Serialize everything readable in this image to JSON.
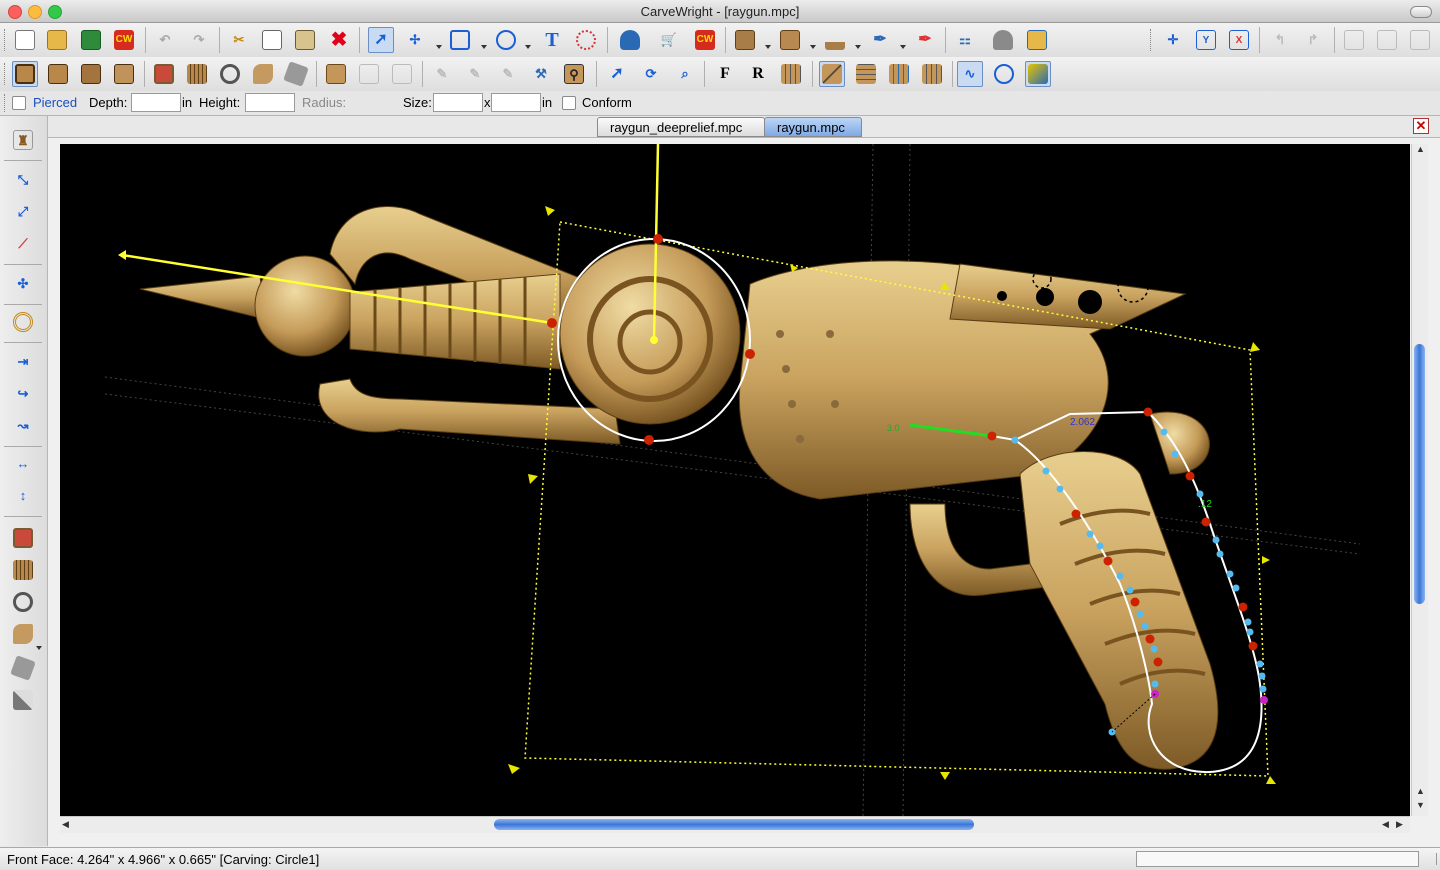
{
  "window": {
    "title": "CarveWright - [raygun.mpc]"
  },
  "toolbar_row1": {
    "icons": [
      "new-file-icon",
      "open-file-icon",
      "save-icon",
      "cw-icon",
      "undo-icon",
      "redo-icon",
      "cut-icon",
      "copy-icon",
      "paste-icon",
      "delete-icon",
      "select-arrow-icon",
      "node-edit-icon",
      "rectangle-icon",
      "circle-icon",
      "text-icon",
      "shell-pattern-icon",
      "shell-icon",
      "cart-icon",
      "cw-red-icon",
      "book-icon",
      "cut-path-icon",
      "bit-icon",
      "feather-icon",
      "feather-alt-icon",
      "tree-icon",
      "duck-icon",
      "folder-view-icon",
      "snap-icon",
      "align-y-icon",
      "align-x-icon",
      "arrow-back-icon",
      "arrow-fwd-icon",
      "mirror-icon",
      "mirror-alt-icon",
      "mirror-alt2-icon"
    ]
  },
  "toolbar_row2": {
    "icons": [
      "board-front-icon",
      "board-alt-icon",
      "board-grain-icon",
      "board-end-icon",
      "emboss-icon",
      "pattern-icon",
      "ring-icon",
      "sculpt-icon",
      "texture-icon",
      "import-icon",
      "copy-shape-icon",
      "copy-shape2-icon",
      "pen-icon",
      "pen2-icon",
      "pen3-icon",
      "bit-tool-icon",
      "keyhole-icon",
      "select-tool-icon",
      "rotate-icon",
      "zoom-icon",
      "f-letter-icon",
      "r-letter-icon",
      "grid-toggle-icon",
      "view-diag-icon",
      "view-grid-icon",
      "view-grid2-icon",
      "view-grid3-icon",
      "curve-icon",
      "circle-view-icon",
      "color-view-icon"
    ]
  },
  "options_bar": {
    "pierced_label": "Pierced",
    "depth_label": "Depth:",
    "height_label": "Height:",
    "radius_label": "Radius:",
    "size_label": "Size:",
    "x_label": "x",
    "in_label": "in",
    "conform_label": "Conform"
  },
  "tabs": [
    {
      "label": "raygun_deeprelief.mpc",
      "active": false
    },
    {
      "label": "raygun.mpc",
      "active": true
    }
  ],
  "canvas": {
    "measure_label_1": "2.062",
    "measure_label_2": ".12",
    "measure_label_3": "3.0"
  },
  "colors": {
    "wood": "#c9a25f",
    "selection_yellow": "#ffff33",
    "node_red": "#cc2200",
    "node_blue": "#55bbee",
    "guide_green": "#22dd22"
  },
  "status": {
    "text": "Front Face: 4.264\" x 4.966\" x 0.665\"    [Carving: Circle1]"
  }
}
